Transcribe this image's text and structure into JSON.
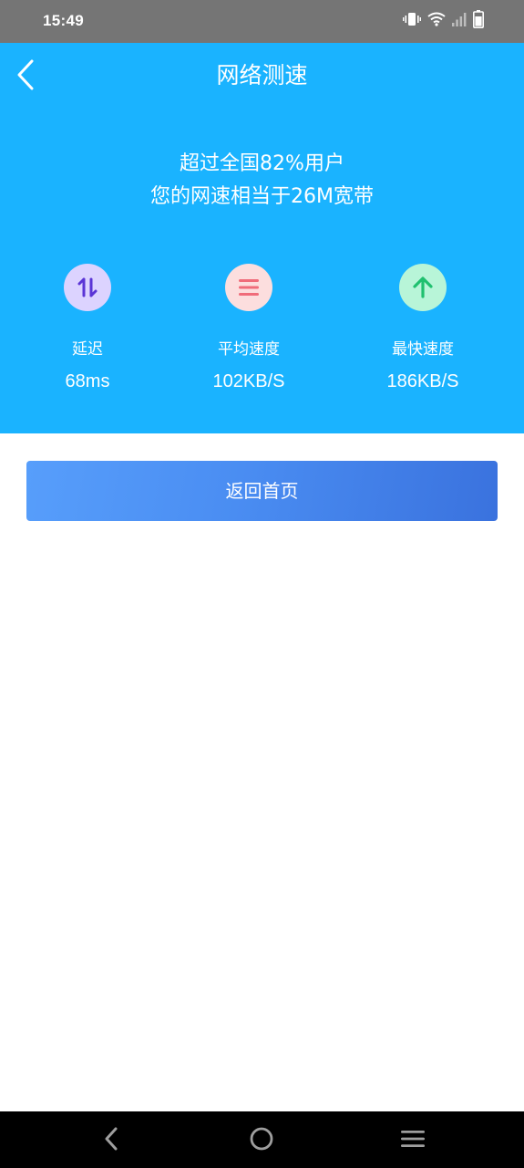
{
  "status_bar": {
    "time": "15:49",
    "icons": [
      "vibrate-icon",
      "wifi-icon",
      "signal-icon",
      "battery-icon"
    ]
  },
  "header": {
    "title": "网络测速",
    "back_icon": "chevron-left-icon"
  },
  "summary": {
    "line1": "超过全国82%用户",
    "line2": "您的网速相当于26M宽带"
  },
  "metrics": [
    {
      "label": "延迟",
      "value": "68ms",
      "icon": "swap-arrows-icon",
      "icon_bg": "#dcd3ff",
      "icon_color": "#5a34d6"
    },
    {
      "label": "平均速度",
      "value": "102KB/S",
      "icon": "menu-lines-icon",
      "icon_bg": "#fcdede",
      "icon_color": "#f06c7a"
    },
    {
      "label": "最快速度",
      "value": "186KB/S",
      "icon": "arrow-up-icon",
      "icon_bg": "#b8f5d8",
      "icon_color": "#1fc06f"
    }
  ],
  "actions": {
    "home_label": "返回首页"
  },
  "system_nav": [
    "back-icon",
    "home-icon",
    "recents-icon"
  ],
  "colors": {
    "status_bar": "#757575",
    "hero_bg": "#1ab3ff",
    "button_gradient_start": "#579efb",
    "button_gradient_end": "#3a72de",
    "nav_bar": "#000000"
  }
}
